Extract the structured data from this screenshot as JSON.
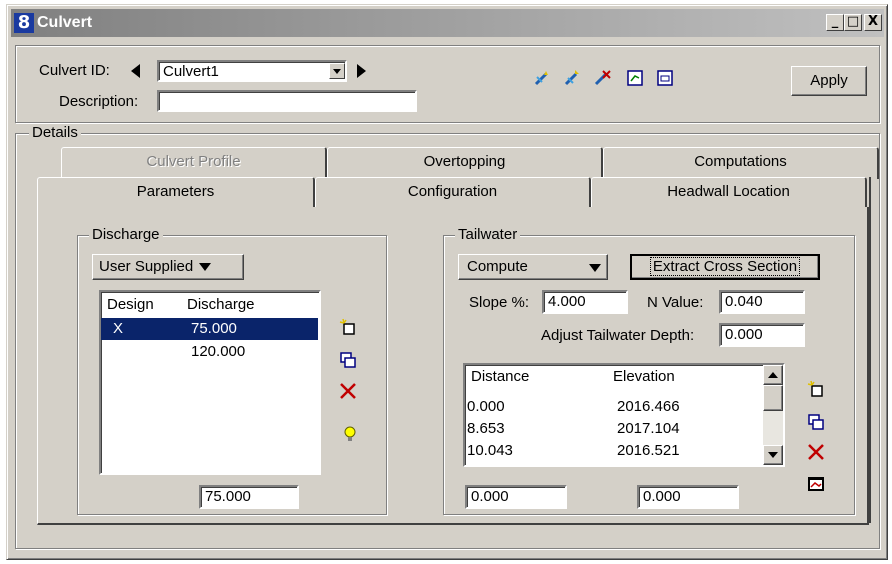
{
  "window": {
    "title": "Culvert",
    "icon": "app-logo-icon"
  },
  "title_buttons": {
    "minimize": "_",
    "maximize": "□",
    "close": "X"
  },
  "header": {
    "culvert_id_label": "Culvert ID:",
    "culvert_id_value": "Culvert1",
    "description_label": "Description:",
    "description_value": "",
    "apply_label": "Apply",
    "toolbar_icons": [
      "new-culvert-icon",
      "duplicate-culvert-icon",
      "delete-culvert-icon",
      "report-icon",
      "profile-view-icon"
    ]
  },
  "details": {
    "label": "Details",
    "tabs_back": [
      {
        "label": "Culvert Profile",
        "enabled": false
      },
      {
        "label": "Overtopping",
        "enabled": true
      },
      {
        "label": "Computations",
        "enabled": true
      }
    ],
    "tabs_front": [
      {
        "label": "Parameters",
        "active": true
      },
      {
        "label": "Configuration",
        "active": false
      },
      {
        "label": "Headwall Location",
        "active": false
      }
    ]
  },
  "discharge": {
    "label": "Discharge",
    "mode": "User Supplied",
    "columns": [
      "Design",
      "Discharge"
    ],
    "rows": [
      {
        "design": "X",
        "discharge": "75.000",
        "selected": true
      },
      {
        "design": "",
        "discharge": "120.000",
        "selected": false
      }
    ],
    "bottom_value": "75.000",
    "icons": [
      "add-row-icon",
      "copy-row-icon",
      "delete-row-icon",
      "lightbulb-icon"
    ]
  },
  "tailwater": {
    "label": "Tailwater",
    "mode": "Compute",
    "extract_button": "Extract Cross Section",
    "slope_label": "Slope %:",
    "slope_value": "4.000",
    "n_label": "N Value:",
    "n_value": "0.040",
    "adjust_label": "Adjust Tailwater Depth:",
    "adjust_value": "0.000",
    "columns": [
      "Distance",
      "Elevation"
    ],
    "rows": [
      {
        "distance": "0.000",
        "elevation": "2016.466"
      },
      {
        "distance": "8.653",
        "elevation": "2017.104"
      },
      {
        "distance": "10.043",
        "elevation": "2016.521"
      }
    ],
    "bottom_left": "0.000",
    "bottom_right": "0.000",
    "icons": [
      "add-row-icon",
      "copy-row-icon",
      "delete-row-icon",
      "chart-view-icon"
    ]
  }
}
